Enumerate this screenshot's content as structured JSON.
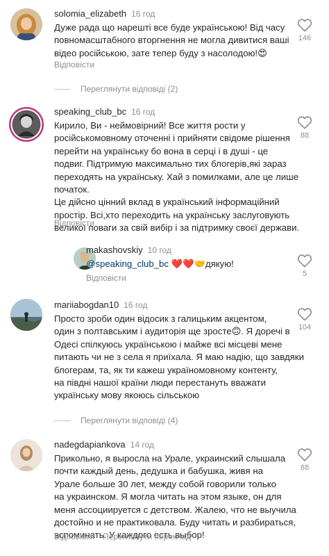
{
  "comments": [
    {
      "username": "solomia_elizabeth",
      "time": "16 год",
      "lines": [
        "Дуже рада що нарешті все буде українською! Від часу",
        "повномасштабного вторгнення не могла дивитися ваші",
        "відео російською, зате тепер буду з насолодою!😍"
      ],
      "reply_label": "Відповісти",
      "likes": "146"
    },
    {
      "username": "speaking_club_bc",
      "time": "16 год",
      "lines": [
        "Кирило, Ви - неймовірний! Все життя рости у",
        "російськомовному оточенні і прийняти свідоме рішення",
        "перейти на українську бо вона в серці і в душі - це",
        "подвиг. Підтримую максимально тих блогерів,які зараз",
        "переходять на українську. Хай з помилками, але це лише",
        "початок.",
        "Це дійсно цінний вклад в український інформаційний",
        "простір. Всі,хто переходить на українську заслуговують",
        "великої поваги за свій вибір і за підтримку своєї держави."
      ],
      "reply_label": "Відповісти",
      "likes": "88"
    },
    {
      "username": "makashovskiy",
      "time": "10 год",
      "mention": "@speaking_club_bc",
      "text_after_mention": " ❤️❤️🤝дякую!",
      "reply_label": "Відповісти",
      "likes": "5"
    },
    {
      "username": "mariiabogdan10",
      "time": "16 год",
      "lines": [
        "Просто зроби один відосик з галицьким акцентом,",
        "один з полтавським і аудиторія ще зросте🙃. Я доречі в",
        "Одесі спілкуюсь українською і майже всі місцеві мене",
        "питають чи не з села я приїхала. Я маю надію, що завдяки",
        "блогерам, та, як ти кажеш україномовному контенту,",
        "на півдні нашої країни люди перестануть вважати",
        "українську мову якоюсь сільською"
      ],
      "likes": "104"
    },
    {
      "username": "nadegdapiankova",
      "time": "14 год",
      "lines": [
        "Прикольно, я выросла на Урале, украинский слышала",
        "почти каждый день, дедушка и бабушка, живя на",
        "Урале больше 30 лет, между собой говорили только",
        "на украинском. Я могла читать на этом языке, он для",
        "меня ассоциируется с детством. Жалею, что не выучила",
        "достойно и не практиковала. Буду читать и разбираться,",
        "вспоминать. У каждого есть выбор!"
      ],
      "reply_label": "Відповісти",
      "translate_label": "Переглянути переклад",
      "likes": "88"
    }
  ],
  "view_replies": [
    {
      "label": "Переглянути відповіді (2)"
    },
    {
      "label": "Переглянути відповіді (4)"
    }
  ],
  "colors": {
    "text": "#262626",
    "secondary": "#8e8e8e",
    "mention": "#00376b"
  }
}
